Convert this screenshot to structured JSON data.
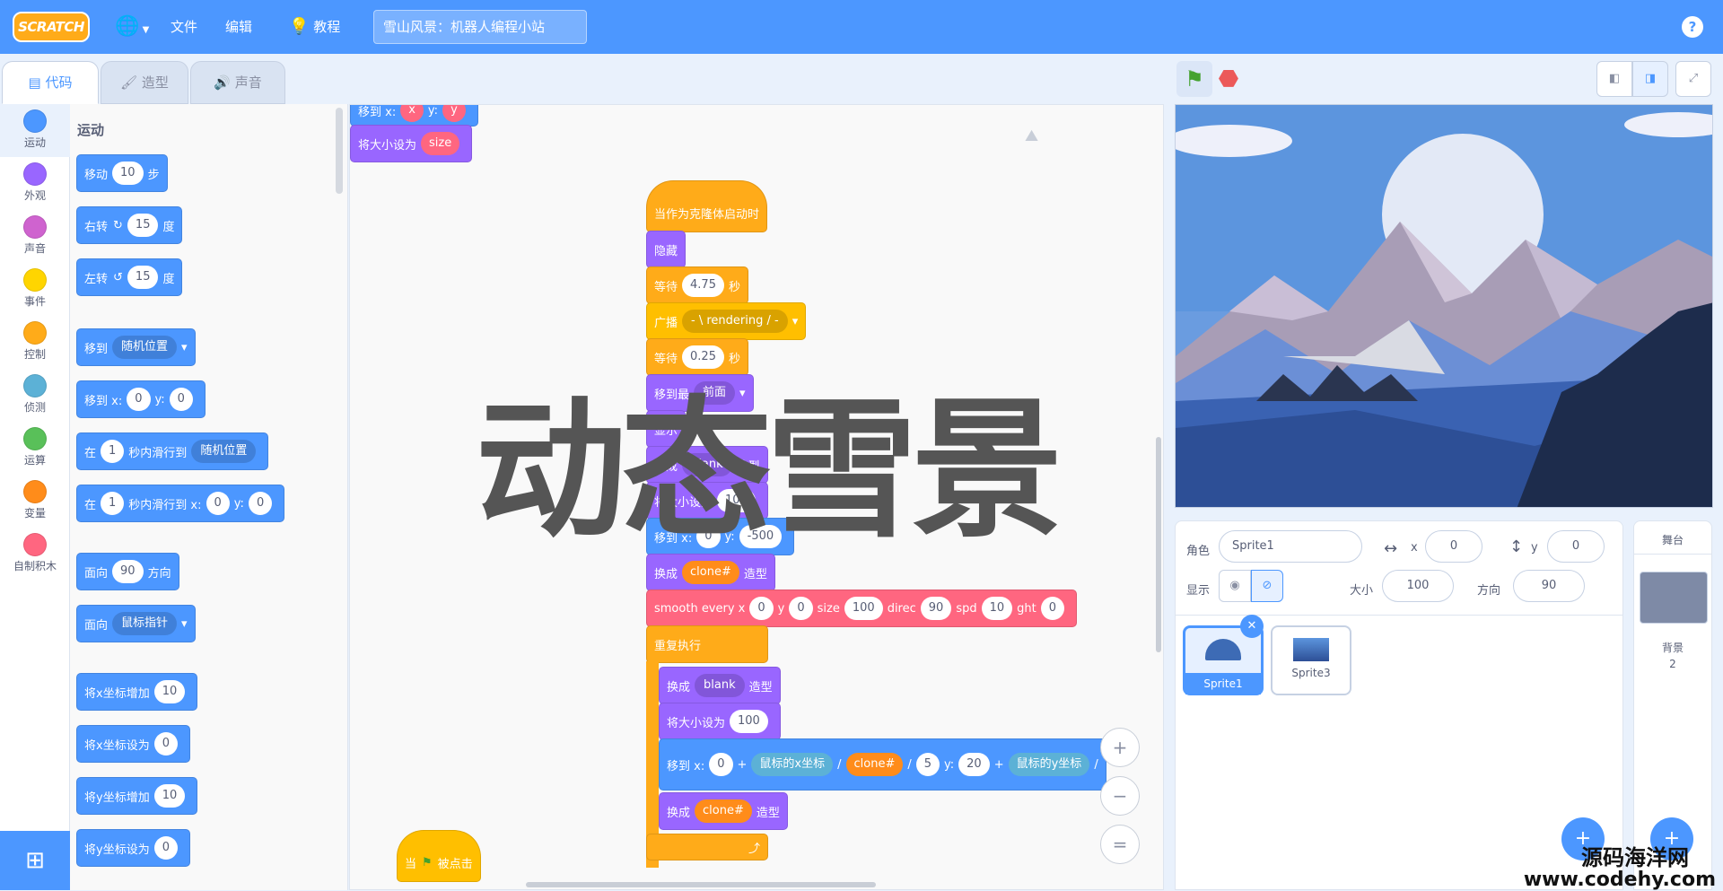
{
  "menubar": {
    "logo": "SCRATCH",
    "file": "文件",
    "edit": "编辑",
    "tutorials": "教程",
    "project_title": "雪山风景：机器人编程小站",
    "help": "?"
  },
  "tabs": [
    {
      "label": "代码",
      "active": true
    },
    {
      "label": "造型",
      "active": false
    },
    {
      "label": "声音",
      "active": false
    }
  ],
  "categories": [
    {
      "label": "运动",
      "color": "#4c97ff"
    },
    {
      "label": "外观",
      "color": "#9966ff"
    },
    {
      "label": "声音",
      "color": "#cf63cf"
    },
    {
      "label": "事件",
      "color": "#ffd500"
    },
    {
      "label": "控制",
      "color": "#ffab19"
    },
    {
      "label": "侦测",
      "color": "#5cb1d6"
    },
    {
      "label": "运算",
      "color": "#59c059"
    },
    {
      "label": "变量",
      "color": "#ff8c1a"
    },
    {
      "label": "自制积木",
      "color": "#ff6680"
    }
  ],
  "palette": {
    "heading": "运动",
    "move": [
      "移动",
      "10",
      "步"
    ],
    "turn_right": [
      "右转",
      "↻",
      "15",
      "度"
    ],
    "turn_left": [
      "左转",
      "↺",
      "15",
      "度"
    ],
    "goto": [
      "移到",
      "随机位置"
    ],
    "goto_xy": [
      "移到 x:",
      "0",
      "y:",
      "0"
    ],
    "glide": [
      "在",
      "1",
      "秒内滑行到",
      "随机位置"
    ],
    "glide_xy": [
      "在",
      "1",
      "秒内滑行到 x:",
      "0",
      "y:",
      "0"
    ],
    "point_dir": [
      "面向",
      "90",
      "方向"
    ],
    "point_towards": [
      "面向",
      "鼠标指针"
    ],
    "change_x": [
      "将x坐标增加",
      "10"
    ],
    "set_x": [
      "将x坐标设为",
      "0"
    ],
    "change_y": [
      "将y坐标增加",
      "10"
    ],
    "set_y": [
      "将y坐标设为",
      "0"
    ]
  },
  "script_top": {
    "goto": [
      "移到 x:",
      "x",
      "y:",
      "y"
    ],
    "set_size": [
      "将大小设为",
      "size"
    ]
  },
  "script_main": {
    "hat": "当作为克隆体启动时",
    "hide": "隐藏",
    "wait1": [
      "等待",
      "4.75",
      "秒"
    ],
    "broadcast": [
      "广播",
      "- \\ rendering / -"
    ],
    "wait2": [
      "等待",
      "0.25",
      "秒"
    ],
    "front": [
      "移到最",
      "前面"
    ],
    "show": "显示",
    "switch1": [
      "换成",
      "blank",
      "造型"
    ],
    "size1": [
      "将大小设为",
      "100"
    ],
    "goto": [
      "移到 x:",
      "0",
      "y:",
      "-500"
    ],
    "switch2": [
      "换成",
      "clone#",
      "造型"
    ],
    "custom": [
      "smooth every x",
      "0",
      "y",
      "0",
      "size",
      "100",
      "direc",
      "90",
      "spd",
      "10",
      "ght",
      "0"
    ],
    "forever": "重复执行",
    "in_switch": [
      "换成",
      "blank",
      "造型"
    ],
    "in_size": [
      "将大小设为",
      "100"
    ],
    "in_goto": [
      "移到 x:",
      "0",
      "+",
      "鼠标的x坐标",
      "/",
      "clone#",
      "/",
      "5",
      "y:",
      "20",
      "+",
      "鼠标的y坐标",
      "/"
    ],
    "in_switch2": [
      "换成",
      "clone#",
      "造型"
    ],
    "loop_arrow": "⤴"
  },
  "script_flag": {
    "label1": "当",
    "label2": "被点击"
  },
  "overlay_text": "动态雪景",
  "zoom": {
    "in": "+",
    "out": "−",
    "reset": "="
  },
  "sprite_info": {
    "sprite_label": "角色",
    "sprite_name": "Sprite1",
    "x_label": "x",
    "x_value": "0",
    "y_label": "y",
    "y_value": "0",
    "show_label": "显示",
    "size_label": "大小",
    "size_value": "100",
    "direction_label": "方向",
    "direction_value": "90"
  },
  "sprites": [
    {
      "name": "Sprite1",
      "selected": true
    },
    {
      "name": "Sprite3",
      "selected": false
    }
  ],
  "stage_panel": {
    "title": "舞台",
    "backdrops_label": "背景",
    "backdrops_count": "2"
  },
  "footer_watermark": {
    "line1": "源码海洋网",
    "line2": "www.codehy.com"
  }
}
